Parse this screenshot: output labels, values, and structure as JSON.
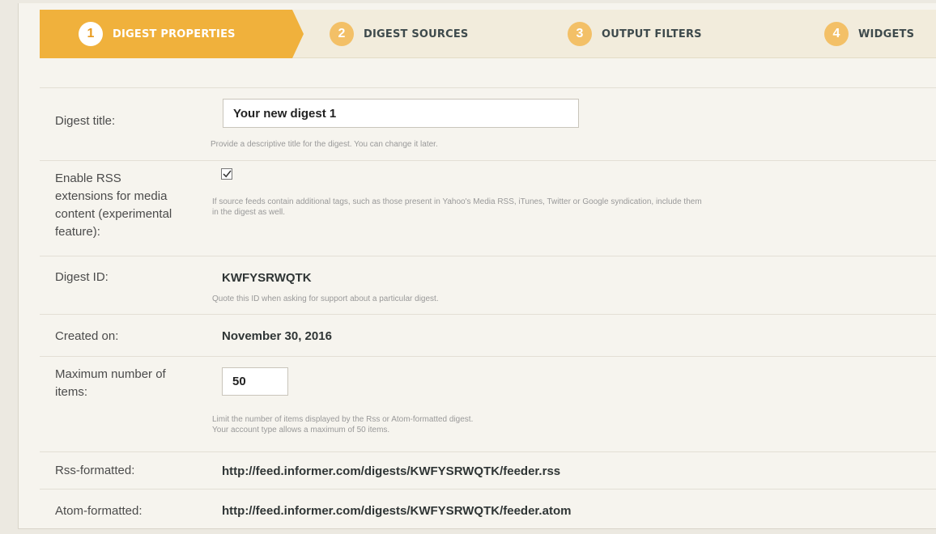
{
  "steps": [
    {
      "number": "1",
      "label": "DIGEST PROPERTIES"
    },
    {
      "number": "2",
      "label": "DIGEST SOURCES"
    },
    {
      "number": "3",
      "label": "OUTPUT FILTERS"
    },
    {
      "number": "4",
      "label": "WIDGETS"
    }
  ],
  "form": {
    "title": {
      "label": "Digest title:",
      "value": "Your new digest 1",
      "hint": "Provide a descriptive title for the digest. You can change it later."
    },
    "rss_ext": {
      "label_lines": [
        "Enable RSS",
        "extensions for media",
        "content (experimental",
        "feature):"
      ],
      "checked": true,
      "hint_lines": [
        "If source feeds contain additional tags, such as those present in Yahoo's Media RSS, iTunes, Twitter or Google syndication, include them",
        "in the digest as well."
      ]
    },
    "digest_id": {
      "label": "Digest ID:",
      "value": "KWFYSRWQTK",
      "hint": "Quote this ID when asking for support about a particular digest."
    },
    "created": {
      "label": "Created on:",
      "value": "November 30, 2016"
    },
    "max_items": {
      "label_lines": [
        "Maximum number of",
        "items:"
      ],
      "value": "50",
      "hint_lines": [
        "Limit the number of items displayed by the Rss or Atom-formatted digest.",
        "Your account type allows a maximum of 50 items."
      ]
    },
    "rss_url": {
      "label": "Rss-formatted:",
      "value": "http://feed.informer.com/digests/KWFYSRWQTK/feeder.rss"
    },
    "atom_url": {
      "label": "Atom-formatted:",
      "value": "http://feed.informer.com/digests/KWFYSRWQTK/feeder.atom"
    }
  },
  "colors": {
    "active_step": "#f0b13c",
    "inactive_step_circle": "#f3c067",
    "link": "#2a5a66"
  }
}
